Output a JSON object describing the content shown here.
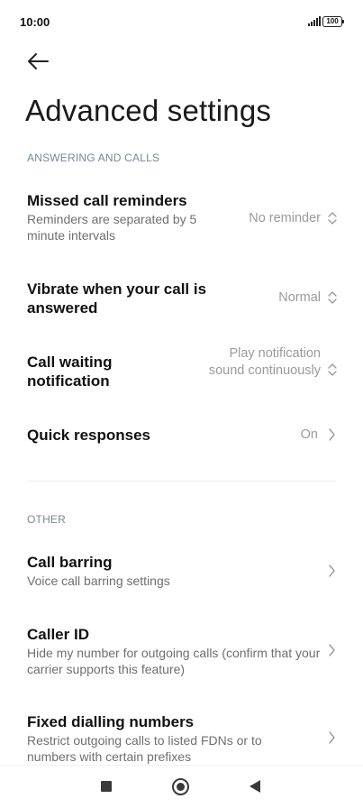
{
  "status_bar": {
    "time": "10:00",
    "battery": "100"
  },
  "header": {
    "title": "Advanced settings"
  },
  "sections": {
    "answering": {
      "label": "ANSWERING AND CALLS",
      "missed_call": {
        "title": "Missed call reminders",
        "subtitle": "Reminders are separated by 5 minute intervals",
        "value": "No reminder"
      },
      "vibrate": {
        "title": "Vibrate when your call is answered",
        "value": "Normal"
      },
      "call_waiting": {
        "title": "Call waiting notification",
        "value": "Play notification sound continuously"
      },
      "quick_responses": {
        "title": "Quick responses",
        "value": "On"
      }
    },
    "other": {
      "label": "OTHER",
      "call_barring": {
        "title": "Call barring",
        "subtitle": "Voice call barring settings"
      },
      "caller_id": {
        "title": "Caller ID",
        "subtitle": "Hide my number for outgoing calls (confirm that your carrier supports this feature)"
      },
      "fdn": {
        "title": "Fixed dialling numbers",
        "subtitle": "Restrict outgoing calls to listed FDNs or to numbers with certain prefixes"
      }
    }
  },
  "icons": {
    "signal": "signal-icon",
    "battery": "battery-icon",
    "back": "arrow-left-icon",
    "dropdown": "chevron-up-down-icon",
    "chevron": "chevron-right-icon",
    "nav_recents": "square-icon",
    "nav_home": "circle-icon",
    "nav_back": "triangle-left-icon"
  },
  "colors": {
    "section_label": "#7b8794",
    "value_text": "#9a9a9a",
    "subtitle_text": "#6f6f6f"
  }
}
